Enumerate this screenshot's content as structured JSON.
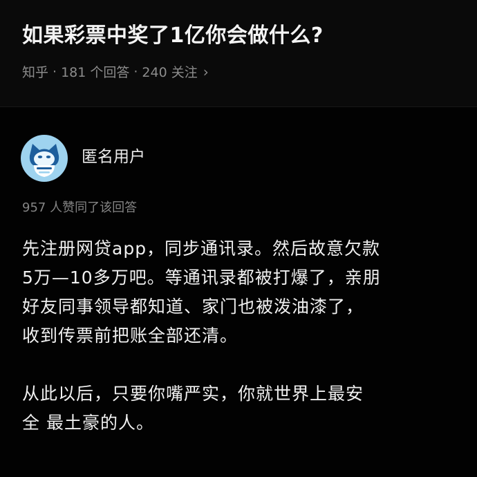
{
  "question": {
    "title": "如果彩票中奖了1亿你会做什么?",
    "source": "知乎",
    "separator": "·",
    "answers": "181 个回答",
    "followers": "240 关注",
    "chevron": "›"
  },
  "answer": {
    "avatar_icon": "anonymous-user-icon",
    "author": "匿名用户",
    "votes": "957 人赞同了该回答",
    "paragraphs": [
      "先注册网贷app，同步通讯录。然后故意欠款\n5万—10多万吧。等通讯录都被打爆了，亲朋\n好友同事领导都知道、家门也被泼油漆了，\n收到传票前把账全部还清。",
      "从此以后，只要你嘴严实，你就世界上最安\n全 最土豪的人。"
    ]
  },
  "colors": {
    "background": "#060606",
    "avatar": "#9ed3ef"
  }
}
